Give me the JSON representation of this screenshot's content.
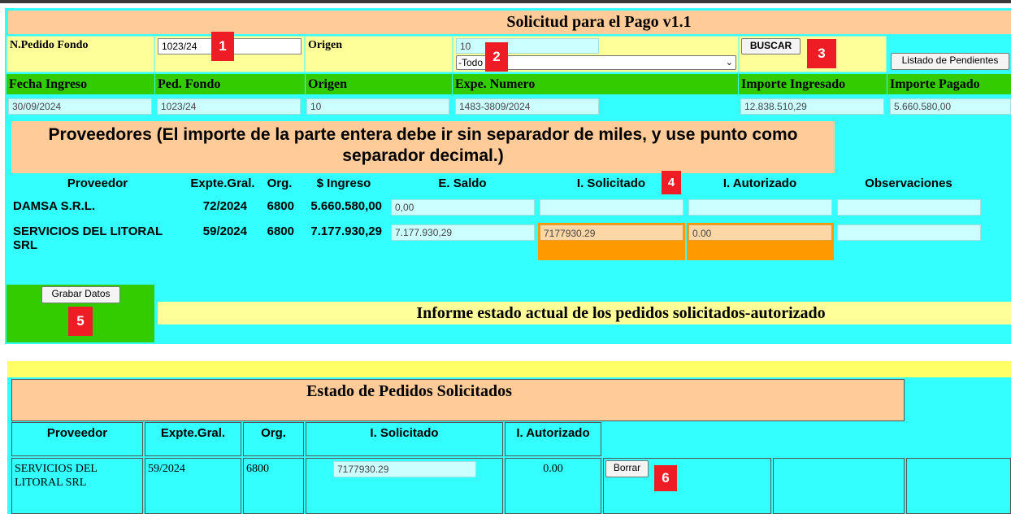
{
  "form": {
    "title": "Solicitud para el Pago v1.1",
    "pedido_label": "N.Pedido Fondo",
    "pedido_value": "1023/24",
    "origen_label": "Origen",
    "origen_value": "10",
    "origen_select": "-Todo",
    "buscar_label": "BUSCAR",
    "pendientes_label": "Listado de Pendientes"
  },
  "info": {
    "headers": [
      "Fecha Ingreso",
      "Ped. Fondo",
      "Origen",
      "Expe. Numero",
      "Importe Ingresado",
      "Importe Pagado"
    ],
    "values": [
      "30/09/2024",
      "1023/24",
      "10",
      "1483-3809/2024",
      "12.838.510,29",
      "5.660.580,00"
    ]
  },
  "proveedores": {
    "heading": "Proveedores (El importe de la parte entera debe ir sin separador de miles, y use punto como separador decimal.)",
    "columns": [
      "Proveedor",
      "Expte.Gral.",
      "Org.",
      "$ Ingreso",
      "E. Saldo",
      "I. Solicitado",
      "I. Autorizado",
      "Observaciones"
    ],
    "rows": [
      {
        "proveedor": "DAMSA S.R.L.",
        "expte": "72/2024",
        "org": "6800",
        "ingreso": "5.660.580,00",
        "saldo": "0,00",
        "solicitado": "",
        "autorizado": "",
        "obs": ""
      },
      {
        "proveedor": "SERVICIOS DEL LITORAL SRL",
        "expte": "59/2024",
        "org": "6800",
        "ingreso": "7.177.930,29",
        "saldo": "7.177.930,29",
        "solicitado": "7177930.29",
        "autorizado": "0.00",
        "obs": ""
      }
    ]
  },
  "actions": {
    "grabar_label": "Grabar Datos"
  },
  "informe": {
    "title": "Informe  estado actual de los pedidos solicitados-autorizado"
  },
  "estado": {
    "title": "Estado de Pedidos Solicitados",
    "columns": [
      "Proveedor",
      "Expte.Gral.",
      "Org.",
      "I. Solicitado",
      "I. Autorizado"
    ],
    "rows": [
      {
        "proveedor": "SERVICIOS DEL LITORAL SRL",
        "expte": "59/2024",
        "org": "6800",
        "solicitado": "7177930.29",
        "autorizado": "0.00",
        "borrar_label": "Borrar"
      }
    ]
  },
  "markers": [
    "1",
    "2",
    "3",
    "4",
    "5",
    "6"
  ],
  "colors": {
    "page_bg": "#33ffff",
    "header_bg": "#ffcc99",
    "green": "#33cc00",
    "yellow": "#ffff99",
    "orange": "#ff9900",
    "marker_red": "#ee1c25"
  }
}
